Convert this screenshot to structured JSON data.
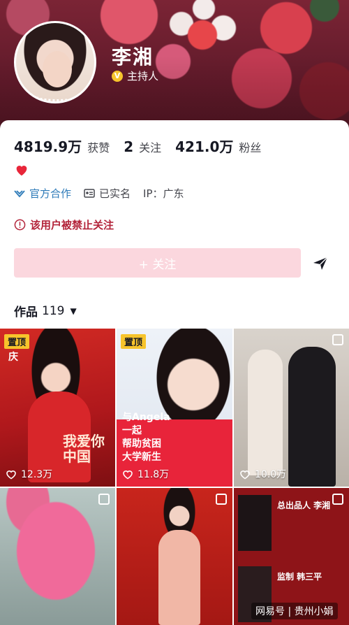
{
  "profile": {
    "name": "李湘",
    "role": "主持人",
    "verified_badge": "V"
  },
  "stats": {
    "likes_value": "4819.9万",
    "likes_label": "获赞",
    "following_value": "2",
    "following_label": "关注",
    "followers_value": "421.0万",
    "followers_label": "粉丝"
  },
  "bio_icon": "heart-emoji",
  "tags": {
    "official": "官方合作",
    "real_name": "已实名",
    "ip": "IP：广东"
  },
  "restriction": "该用户被禁止关注",
  "follow_button": "+ 关注",
  "works": {
    "label": "作品",
    "count": "119",
    "arrow": "▼"
  },
  "videos": [
    {
      "pinned": "置顶",
      "likes": "12.3万",
      "overlay": "我爱你中国",
      "corner": "庆"
    },
    {
      "pinned": "置顶",
      "likes": "11.8万",
      "overlay_lines": [
        "与Angela",
        "一起",
        "帮助贫困",
        "大学新生"
      ]
    },
    {
      "likes": "10.0万"
    },
    {},
    {},
    {
      "lines": [
        "总出品人 李湘",
        "监制 韩三平"
      ]
    }
  ],
  "watermark": "网易号 | 贵州小娟",
  "colors": {
    "accent": "#fe2c55",
    "follow_button_bg": "#fbd7de",
    "official_blue": "#2c7ab8",
    "ban_red": "#b3243a",
    "pin_yellow": "#f7c42c"
  }
}
